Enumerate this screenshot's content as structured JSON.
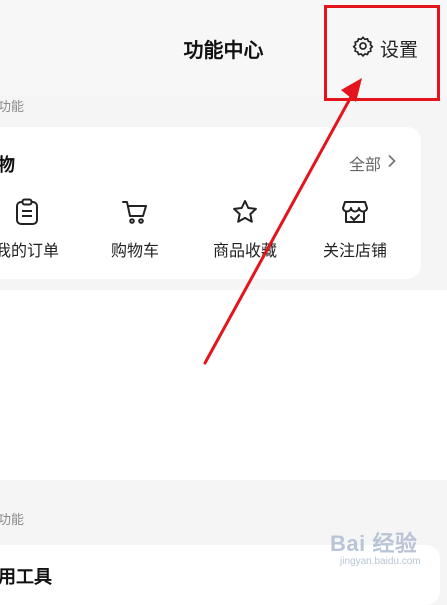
{
  "header": {
    "title": "功能中心",
    "settings_label": "设置"
  },
  "section1": {
    "label": "功能",
    "card": {
      "title": "物",
      "view_all_label": "全部",
      "items": [
        {
          "label": "我的订单",
          "icon": "clipboard-icon"
        },
        {
          "label": "购物车",
          "icon": "cart-icon"
        },
        {
          "label": "商品收藏",
          "icon": "star-icon"
        },
        {
          "label": "关注店铺",
          "icon": "store-icon"
        }
      ]
    }
  },
  "section2": {
    "label": "功能",
    "card": {
      "title": "用工具"
    }
  },
  "annotation": {
    "color": "#e3141b"
  },
  "watermark": {
    "text": "Bai 经验",
    "sub": "jingyan.baidu.com"
  }
}
